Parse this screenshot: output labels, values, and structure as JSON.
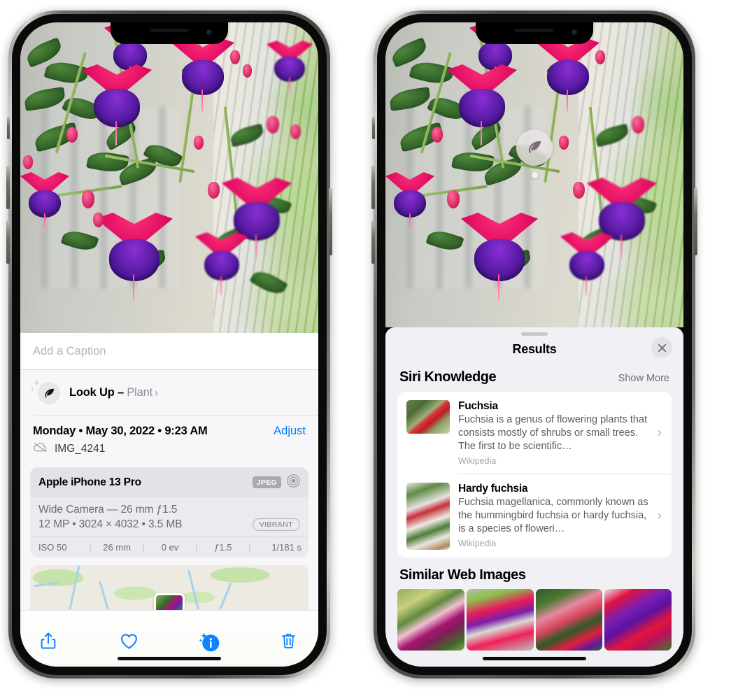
{
  "left_phone": {
    "name": "photos-detail-view",
    "caption": {
      "placeholder": "Add a Caption",
      "value": ""
    },
    "lookup": {
      "icon": "leaf-icon",
      "label": "Look Up",
      "dash": " – ",
      "subject": "Plant",
      "chevron": "›"
    },
    "date": {
      "text": "Monday • May 30, 2022 • 9:23 AM",
      "adjust_label": "Adjust",
      "filename": "IMG_4241",
      "cloud_icon": "cloud-slash-icon"
    },
    "camera": {
      "model": "Apple iPhone 13 Pro",
      "format_badge": "JPEG",
      "lens_icon": "aperture-icon",
      "lens_line": "Wide Camera — 26 mm ƒ1.5",
      "specs_line": "12 MP • 3024 × 4032 • 3.5 MB",
      "profile_badge": "VIBRANT",
      "exif": [
        "ISO 50",
        "26 mm",
        "0 ev",
        "ƒ1.5",
        "1/181 s"
      ]
    },
    "toolbar": [
      {
        "name": "share-button",
        "icon": "share-icon"
      },
      {
        "name": "favorite-button",
        "icon": "heart-icon"
      },
      {
        "name": "info-button",
        "icon": "info-sparkle-icon"
      },
      {
        "name": "delete-button",
        "icon": "trash-icon"
      }
    ]
  },
  "right_phone": {
    "name": "visual-look-up-results",
    "badge": {
      "icon": "leaf-icon"
    },
    "sheet": {
      "title": "Results",
      "close_label": "✕",
      "siri_knowledge": {
        "title": "Siri Knowledge",
        "show_more": "Show More",
        "items": [
          {
            "title": "Fuchsia",
            "description": "Fuchsia is a genus of flowering plants that consists mostly of shrubs or small trees. The first to be scientific…",
            "source": "Wikipedia",
            "chevron": "›"
          },
          {
            "title": "Hardy fuchsia",
            "description": "Fuchsia magellanica, commonly known as the hummingbird fuchsia or hardy fuchsia, is a species of floweri…",
            "source": "Wikipedia",
            "chevron": "›"
          }
        ]
      },
      "similar_web_images": {
        "title": "Similar Web Images",
        "count": 4
      }
    }
  },
  "colors": {
    "accent_blue": "#007aff",
    "tint_blue": "#0a84ff",
    "panel_bg": "#f7f7f9",
    "sheet_bg": "#f1f1f5",
    "card_bg": "#ffffff",
    "secondary_text": "#8e8e93",
    "badge_gray": "#a9a9b0"
  }
}
